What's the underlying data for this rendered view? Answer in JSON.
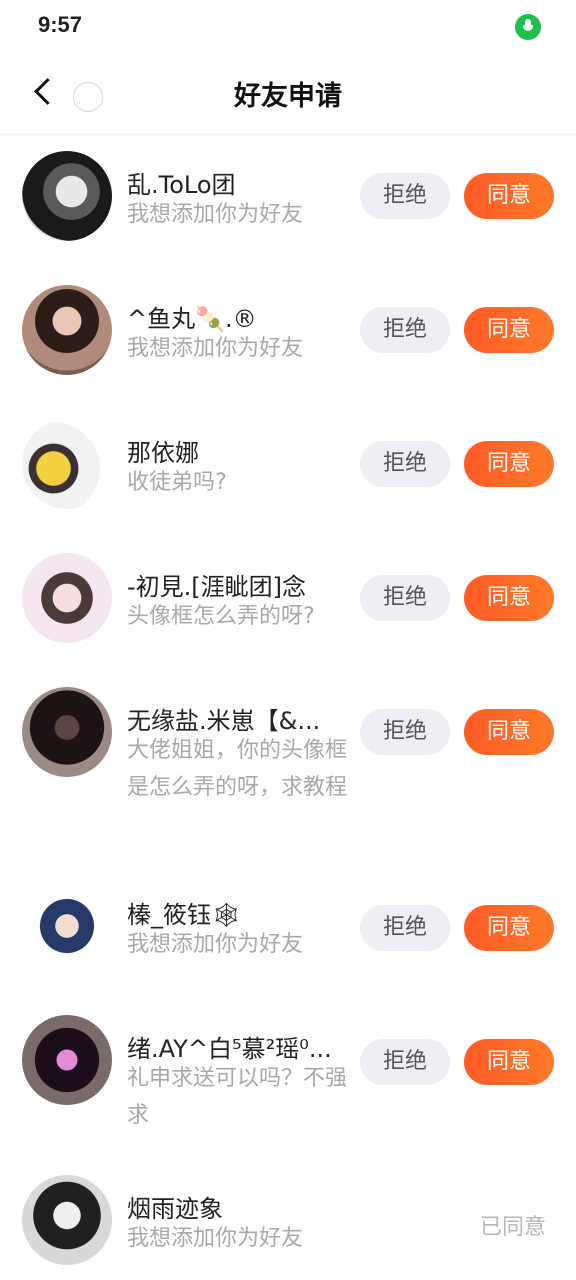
{
  "status": {
    "time": "9:57"
  },
  "nav": {
    "title": "好友申请"
  },
  "buttons": {
    "reject": "拒绝",
    "accept": "同意",
    "accepted": "已同意"
  },
  "requests": [
    {
      "name": "乱.ToLo团",
      "message": "我想添加你为好友",
      "status": "pending"
    },
    {
      "name": "^鱼丸🍡.®",
      "message": "我想添加你为好友",
      "status": "pending"
    },
    {
      "name": "那依娜",
      "message": "收徒弟吗?",
      "status": "pending"
    },
    {
      "name": "-初見.[涯眦团]念",
      "message": "头像框怎么弄的呀?",
      "status": "pending"
    },
    {
      "name": "无缘盐.米崽【&...",
      "message": "大佬姐姐，你的头像框是怎么弄的呀，求教程",
      "status": "pending"
    },
    {
      "name": "榛_筱钰🕸",
      "message": "我想添加你为好友",
      "status": "pending"
    },
    {
      "name": "绪.AY^白⁵慕²瑶⁰...",
      "message": "礼申求送可以吗？不强求",
      "status": "pending"
    },
    {
      "name": "烟雨迹象",
      "message": "我想添加你为好友",
      "status": "accepted"
    }
  ],
  "colors": {
    "accent": "#ff5a26",
    "status_mic": "#1fbf4b"
  }
}
